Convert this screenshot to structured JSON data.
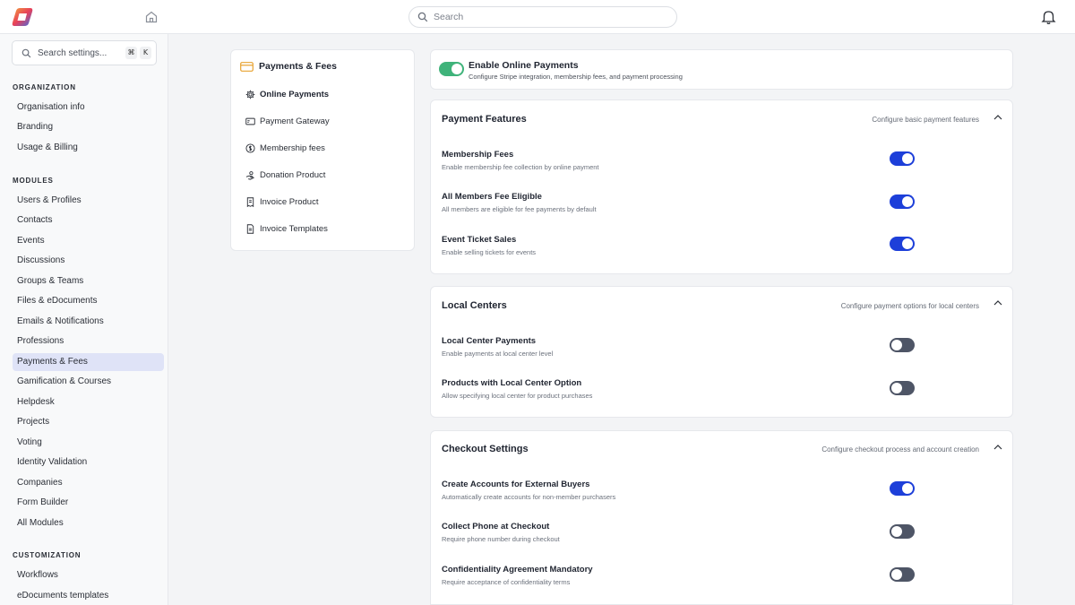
{
  "header": {
    "search_placeholder": "Search"
  },
  "sidebar": {
    "search_placeholder": "Search settings...",
    "shortcut_keys": [
      "⌘",
      "K"
    ],
    "sections": [
      {
        "title": "ORGANIZATION",
        "items": [
          "Organisation info",
          "Branding",
          "Usage & Billing"
        ]
      },
      {
        "title": "MODULES",
        "items": [
          "Users & Profiles",
          "Contacts",
          "Events",
          "Discussions",
          "Groups & Teams",
          "Files & eDocuments",
          "Emails & Notifications",
          "Professions",
          "Payments & Fees",
          "Gamification & Courses",
          "Helpdesk",
          "Projects",
          "Voting",
          "Identity Validation",
          "Companies",
          "Form Builder",
          "All Modules"
        ]
      },
      {
        "title": "CUSTOMIZATION",
        "items": [
          "Workflows",
          "eDocuments templates"
        ]
      }
    ],
    "active_item": "Payments & Fees"
  },
  "subnav": {
    "title": "Payments & Fees",
    "items": [
      {
        "label": "Online Payments",
        "icon": "gear-icon",
        "active": true
      },
      {
        "label": "Payment Gateway",
        "icon": "card-icon",
        "active": false
      },
      {
        "label": "Membership fees",
        "icon": "coin-icon",
        "active": false
      },
      {
        "label": "Donation Product",
        "icon": "hand-icon",
        "active": false
      },
      {
        "label": "Invoice Product",
        "icon": "invoice-icon",
        "active": false
      },
      {
        "label": "Invoice Templates",
        "icon": "document-icon",
        "active": false
      }
    ]
  },
  "enable_banner": {
    "title": "Enable Online Payments",
    "description": "Configure Stripe integration, membership fees, and payment processing",
    "enabled": true
  },
  "sections": [
    {
      "title": "Payment Features",
      "hint": "Configure basic payment features",
      "rows": [
        {
          "title": "Membership Fees",
          "description": "Enable membership fee collection by online payment",
          "on": true
        },
        {
          "title": "All Members Fee Eligible",
          "description": "All members are eligible for fee payments by default",
          "on": true
        },
        {
          "title": "Event Ticket Sales",
          "description": "Enable selling tickets for events",
          "on": true
        }
      ]
    },
    {
      "title": "Local Centers",
      "hint": "Configure payment options for local centers",
      "rows": [
        {
          "title": "Local Center Payments",
          "description": "Enable payments at local center level",
          "on": false
        },
        {
          "title": "Products with Local Center Option",
          "description": "Allow specifying local center for product purchases",
          "on": false
        }
      ]
    },
    {
      "title": "Checkout Settings",
      "hint": "Configure checkout process and account creation",
      "rows": [
        {
          "title": "Create Accounts for External Buyers",
          "description": "Automatically create accounts for non-member purchasers",
          "on": true
        },
        {
          "title": "Collect Phone at Checkout",
          "description": "Require phone number during checkout",
          "on": false
        },
        {
          "title": "Confidentiality Agreement Mandatory",
          "description": "Require acceptance of confidentiality terms",
          "on": false
        }
      ]
    }
  ],
  "colors": {
    "accent": "#1d3fd9",
    "toggle_off": "#4e5566",
    "toggle_green": "#3fb37a",
    "active_nav": "#dfe3f7"
  }
}
